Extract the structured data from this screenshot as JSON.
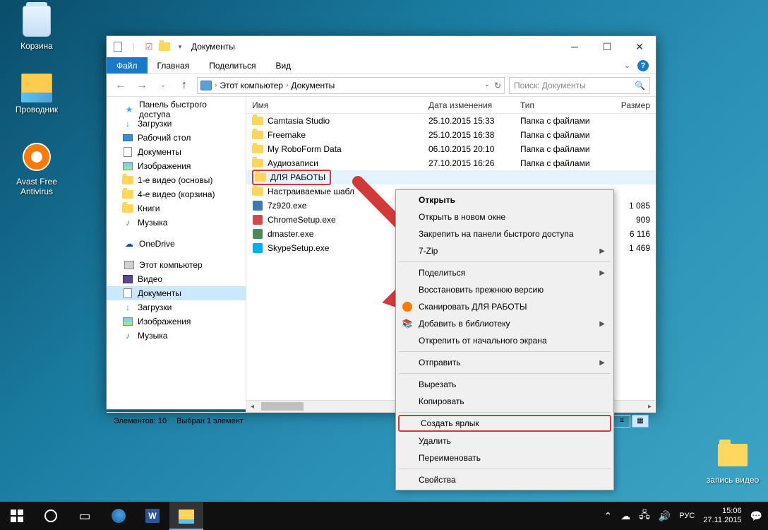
{
  "desktop": {
    "icons": [
      {
        "name": "recycle-bin",
        "label": "Корзина"
      },
      {
        "name": "explorer",
        "label": "Проводник"
      },
      {
        "name": "avast",
        "label": "Avast Free Antivirus"
      }
    ],
    "bottom_right_folder": "запись видео"
  },
  "window": {
    "title": "Документы",
    "tabs": {
      "file": "Файл",
      "main": "Главная",
      "share": "Поделиться",
      "view": "Вид"
    },
    "breadcrumb": [
      "Этот компьютер",
      "Документы"
    ],
    "search_placeholder": "Поиск: Документы",
    "columns": {
      "name": "Имя",
      "date": "Дата изменения",
      "type": "Тип",
      "size": "Размер"
    },
    "nav": {
      "quick": "Панель быстрого доступа",
      "quick_items": [
        "Загрузки",
        "Рабочий стол",
        "Документы",
        "Изображения",
        "1-е видео (основы)",
        "4-е видео (корзина)",
        "Книги",
        "Музыка"
      ],
      "onedrive": "OneDrive",
      "pc": "Этот компьютер",
      "pc_items": [
        "Видео",
        "Документы",
        "Загрузки",
        "Изображения",
        "Музыка"
      ]
    },
    "files": [
      {
        "name": "Camtasia Studio",
        "date": "25.10.2015 15:33",
        "type": "Папка с файлами",
        "size": "",
        "kind": "folder"
      },
      {
        "name": "Freemake",
        "date": "25.10.2015 16:38",
        "type": "Папка с файлами",
        "size": "",
        "kind": "folder"
      },
      {
        "name": "My RoboForm Data",
        "date": "06.10.2015 20:10",
        "type": "Папка с файлами",
        "size": "",
        "kind": "folder"
      },
      {
        "name": "Аудиозаписи",
        "date": "27.10.2015 16:26",
        "type": "Папка с файлами",
        "size": "",
        "kind": "folder"
      },
      {
        "name": "ДЛЯ РАБОТЫ",
        "date": "",
        "type": "",
        "size": "",
        "kind": "folder",
        "selected": true
      },
      {
        "name": "Настраиваемые шабл",
        "date": "",
        "type": "",
        "size": "",
        "kind": "folder"
      },
      {
        "name": "7z920.exe",
        "date": "",
        "type": "",
        "size": "1 085",
        "kind": "exe",
        "color": "#3a7ab0"
      },
      {
        "name": "ChromeSetup.exe",
        "date": "",
        "type": "",
        "size": "909",
        "kind": "exe",
        "color": "#d04a4a"
      },
      {
        "name": "dmaster.exe",
        "date": "",
        "type": "",
        "size": "6 116",
        "kind": "exe",
        "color": "#4a8a5a"
      },
      {
        "name": "SkypeSetup.exe",
        "date": "",
        "type": "",
        "size": "1 469",
        "kind": "exe",
        "color": "#00aff0"
      }
    ],
    "status": {
      "count": "Элементов: 10",
      "selected": "Выбран 1 элемент"
    }
  },
  "context_menu": {
    "items": [
      {
        "label": "Открыть",
        "bold": true
      },
      {
        "label": "Открыть в новом окне"
      },
      {
        "label": "Закрепить на панели быстрого доступа"
      },
      {
        "label": "7-Zip",
        "sub": true
      },
      {
        "sep": true
      },
      {
        "label": "Поделиться",
        "sub": true
      },
      {
        "label": "Восстановить прежнюю версию"
      },
      {
        "label": "Сканировать ДЛЯ РАБОТЫ",
        "icon": "avast"
      },
      {
        "label": "Добавить в библиотеку",
        "sub": true,
        "icon": "lib"
      },
      {
        "label": "Открепить от начального экрана"
      },
      {
        "sep": true
      },
      {
        "label": "Отправить",
        "sub": true
      },
      {
        "sep": true
      },
      {
        "label": "Вырезать"
      },
      {
        "label": "Копировать"
      },
      {
        "sep": true
      },
      {
        "label": "Создать ярлык",
        "highlight": true
      },
      {
        "label": "Удалить"
      },
      {
        "label": "Переименовать"
      },
      {
        "sep": true
      },
      {
        "label": "Свойства"
      }
    ]
  },
  "taskbar": {
    "lang": "РУС",
    "time": "15:06",
    "date": "27.11.2015"
  }
}
